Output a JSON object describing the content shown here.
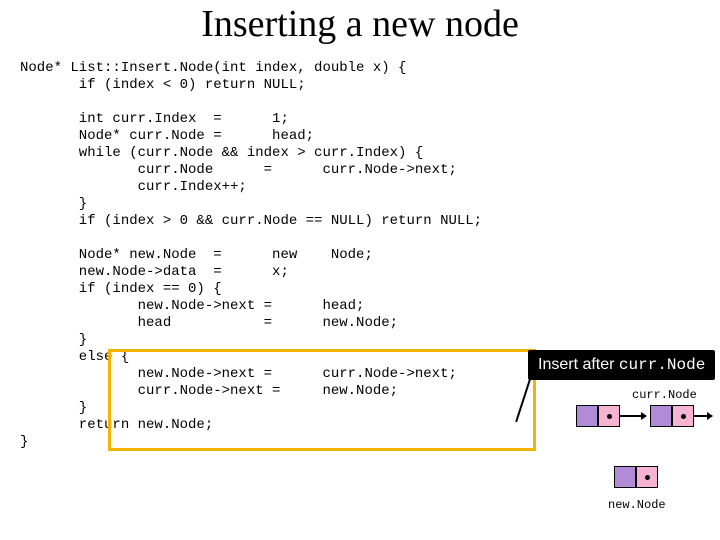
{
  "title": "Inserting a new node",
  "code": "Node* List::Insert.Node(int index, double x) {\n       if (index < 0) return NULL;\n\n       int curr.Index  =      1;\n       Node* curr.Node =      head;\n       while (curr.Node && index > curr.Index) {\n              curr.Node      =      curr.Node->next;\n              curr.Index++;\n       }\n       if (index > 0 && curr.Node == NULL) return NULL;\n\n       Node* new.Node  =      new    Node;\n       new.Node->data  =      x;\n       if (index == 0) {\n              new.Node->next =      head;\n              head           =      new.Node;\n       }\n       else {\n              new.Node->next =      curr.Node->next;\n              curr.Node->next =     new.Node;\n       }\n       return new.Node;\n}",
  "callout": {
    "prefix": "Insert after ",
    "mono": "curr.Node"
  },
  "labels": {
    "curr": "curr.Node",
    "newn": "new.Node"
  }
}
